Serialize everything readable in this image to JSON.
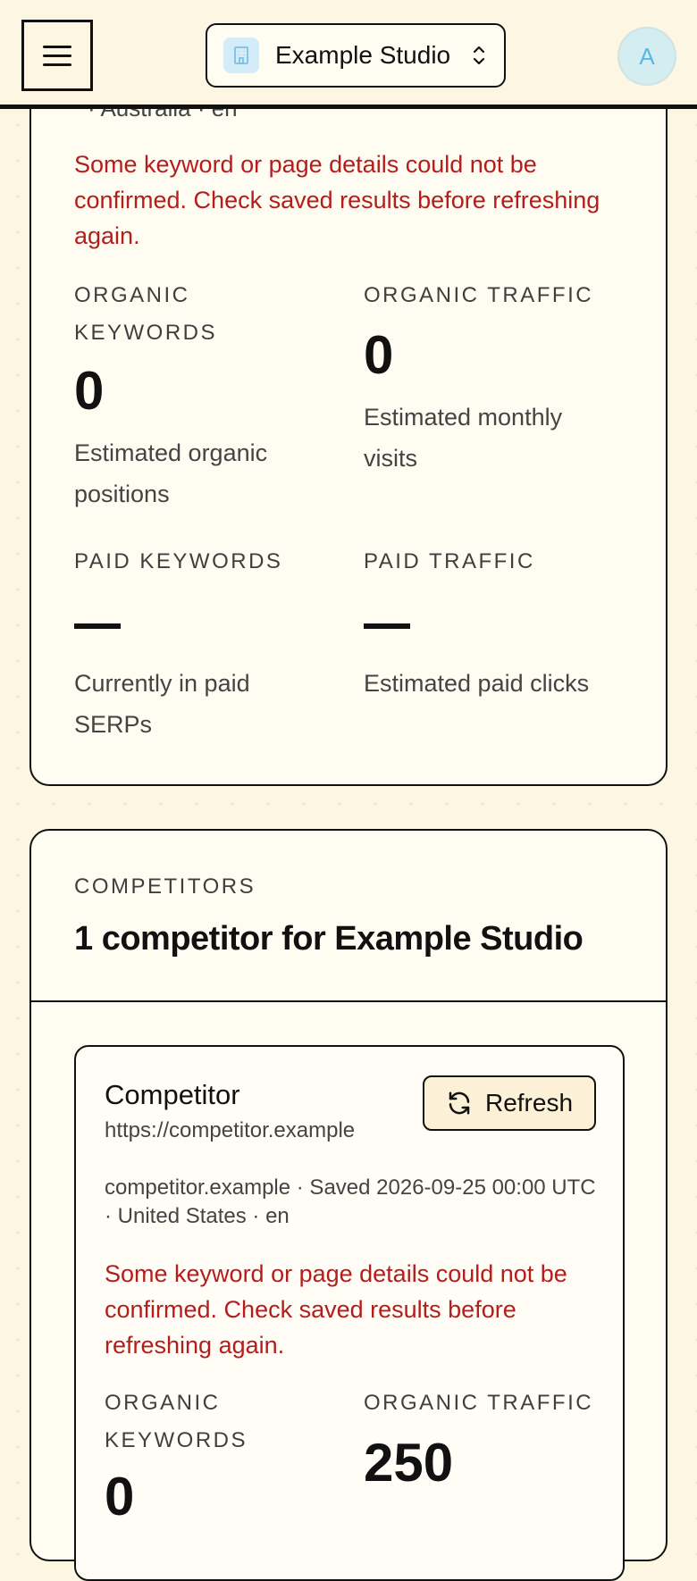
{
  "header": {
    "workspace_name": "Example Studio",
    "avatar_initial": "A",
    "icons": {
      "menu": "hamburger-icon",
      "workspace": "building-icon",
      "switcher": "chevron-up-down-icon"
    },
    "accent_color": "#58b8e6"
  },
  "site_card": {
    "top_text": "· Australia · en",
    "error": "Some keyword or page details could not be confirmed. Check saved results before refreshing again.",
    "metrics": {
      "organic_keywords": {
        "label": "ORGANIC KEYWORDS",
        "value": "0",
        "sub": "Estimated organic positions"
      },
      "organic_traffic": {
        "label": "ORGANIC TRAFFIC",
        "value": "0",
        "sub": "Estimated monthly visits"
      },
      "paid_keywords": {
        "label": "PAID KEYWORDS",
        "value": "—",
        "sub": "Currently in paid SERPs"
      },
      "paid_traffic": {
        "label": "PAID TRAFFIC",
        "value": "—",
        "sub": "Estimated paid clicks"
      }
    }
  },
  "competitors": {
    "eyebrow": "COMPETITORS",
    "title": "1 competitor for Example Studio",
    "items": [
      {
        "name": "Competitor",
        "url": "https://competitor.example",
        "refresh_label": "Refresh",
        "meta": "competitor.example · Saved 2026-09-25 00:00 UTC · United States · en",
        "error": "Some keyword or page details could not be confirmed. Check saved results before refreshing again.",
        "organic_keywords_label": "ORGANIC KEYWORDS",
        "organic_keywords_value": "0",
        "organic_traffic_label": "ORGANIC TRAFFIC",
        "organic_traffic_value": "250"
      }
    ]
  },
  "colors": {
    "error": "#b51d1d",
    "background": "#fdf6e3",
    "card": "#fffcf2"
  }
}
